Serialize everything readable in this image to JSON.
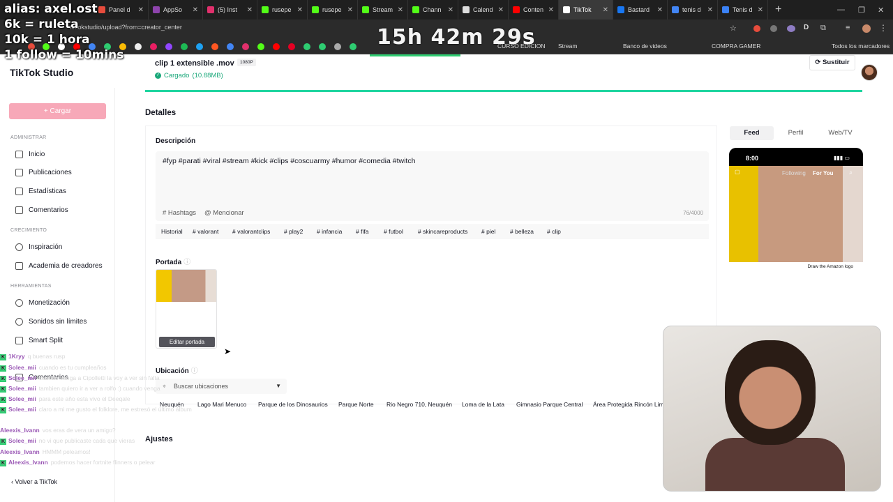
{
  "overlay": {
    "line1": "alias: axel.ost",
    "line2": "6k = ruleta",
    "line3": "10k = 1 hora",
    "line4": "1 follow = 10mins"
  },
  "timer": "15h 42m 29s",
  "browser": {
    "tabs": [
      {
        "label": "Panel d",
        "color": "#e74c3c"
      },
      {
        "label": "AppSo",
        "color": "#8e44ad"
      },
      {
        "label": "(5) Inst",
        "color": "#e1306c"
      },
      {
        "label": "rusepe",
        "color": "#53fc18"
      },
      {
        "label": "rusepe",
        "color": "#53fc18"
      },
      {
        "label": "Stream",
        "color": "#53fc18"
      },
      {
        "label": "Chann",
        "color": "#53fc18"
      },
      {
        "label": "Calend",
        "color": "#dddddd"
      },
      {
        "label": "Conten",
        "color": "#ff0000"
      },
      {
        "label": "TikTok",
        "color": "#ffffff"
      },
      {
        "label": "Bastard",
        "color": "#1877f2"
      },
      {
        "label": "tenis d",
        "color": "#4285f4"
      },
      {
        "label": "Tenis d",
        "color": "#3b82f6"
      }
    ],
    "active_tab_index": 9,
    "url": "tiktokstudio/upload?from=creator_center",
    "bookmarks": [
      {
        "label": "CURSO EDICION"
      },
      {
        "label": "Stream"
      },
      {
        "label": "Banco de videos"
      },
      {
        "label": "COMPRA GAMER"
      },
      {
        "label": "Todos los marcadores"
      }
    ]
  },
  "app": {
    "logo": "TikTok Studio",
    "upload_label": "+ Cargar",
    "sections": {
      "admin": "ADMINISTRAR",
      "growth": "CRECIMIENTO",
      "tools": "HERRAMIENTAS"
    },
    "nav": {
      "inicio": "Inicio",
      "publicaciones": "Publicaciones",
      "estadisticas": "Estadísticas",
      "comentarios": "Comentarios",
      "inspiracion": "Inspiración",
      "academia": "Academia de creadores",
      "monetizacion": "Monetización",
      "sonidos": "Sonidos sin límites",
      "smart_split": "Smart Split",
      "comentarios2": "Comentarios"
    },
    "back_link": "‹  Volver a TikTok"
  },
  "file": {
    "name": "clip 1 extensible .mov",
    "resolution": "1080P",
    "status": "Cargado",
    "size": "(10.88MB)",
    "replace_label": "Sustituir"
  },
  "details": {
    "title": "Detalles",
    "description_label": "Descripción",
    "description_text": "#fyp  #parati  #viral  #stream  #kick  #clips  #coscuarmy  #humor  #comedia  #twitch",
    "hashtags_label": "# Hashtags",
    "mention_label": "@ Mencionar",
    "char_count": "76/4000",
    "tags": [
      "Historial",
      "# valorant",
      "# valorantclips",
      "# play2",
      "# infancia",
      "# fifa",
      "# futbol",
      "# skincareproducts",
      "# piel",
      "# belleza",
      "# clip"
    ],
    "cover_label": "Portada",
    "edit_cover_label": "Editar portada",
    "location_label": "Ubicación",
    "location_placeholder": "Buscar ubicaciones",
    "locations": [
      "Neuquén",
      "Lago Mari Menuco",
      "Parque de los Dinosaurios",
      "Parque Norte",
      "Rio Negro 710, Neuquén",
      "Loma de la Lata",
      "Gimnasio Parque Central",
      "Área Protegida Rincón Lima"
    ],
    "settings_title": "Ajustes"
  },
  "preview": {
    "tabs": [
      "Feed",
      "Perfil",
      "Web/TV"
    ],
    "active_tab": "Feed",
    "time": "8:00",
    "following": "Following",
    "for_you": "For You",
    "caption": "Draw the Amazon logo"
  },
  "chat": [
    {
      "user": "1Kryy",
      "msg": "q buenas rusp"
    },
    {
      "user": "Solee_mii",
      "msg": "cuando es tu cumpleaños"
    },
    {
      "user": "Solee_mii",
      "msg": "cuando venga a Cipolletti la voy a ver sin falta"
    },
    {
      "user": "Solee_mii",
      "msg": "tambien quiero ir a ver a rolfo :) cuando venga"
    },
    {
      "user": "Solee_mii",
      "msg": "para este año esta vivo el Deeqale"
    },
    {
      "user": "Solee_mii",
      "msg": "claro a mi me gusto el folklore, me estresó el último álbum"
    },
    {
      "user": "Aleexis_Ivann",
      "msg": "vos eras de vera un amigo?"
    },
    {
      "user": "Solee_mii",
      "msg": "no vi que publicaste cada que vieras"
    },
    {
      "user": "Aleexis_Ivann",
      "msg": "HMMM peleamos!"
    },
    {
      "user": "Aleexis_Ivann",
      "msg": "podemos hacer fortnite flinners o pelear"
    }
  ]
}
